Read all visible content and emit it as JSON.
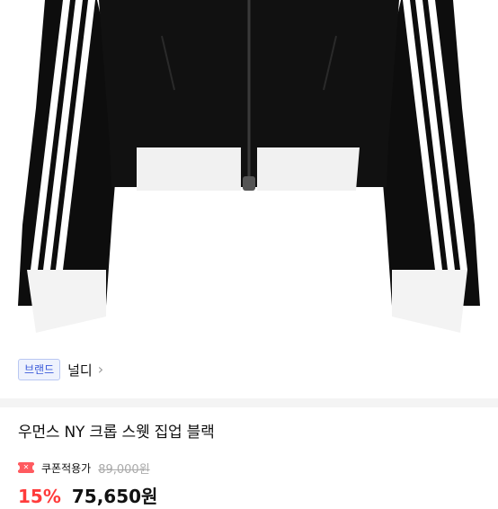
{
  "brand": {
    "chip_label": "브랜드",
    "name": "널디",
    "chevron": "›"
  },
  "product": {
    "title": "우먼스 NY 크롭 스웻 집업 블랙",
    "image_icon": "product-photo-track-jacket"
  },
  "price": {
    "coupon_icon_glyph": "✕",
    "coupon_label": "쿠폰적용가",
    "original": "89,000원",
    "discount": "15%",
    "final": "75,650원"
  },
  "colors": {
    "discount": "#ff3b3b",
    "brand_chip": "#3a5ad9",
    "coupon": "#ff5a5f"
  }
}
